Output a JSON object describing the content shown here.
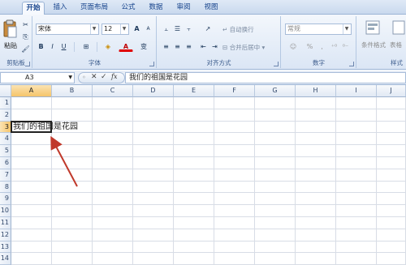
{
  "tabs": [
    {
      "label": "开始",
      "active": true
    },
    {
      "label": "插入"
    },
    {
      "label": "页面布局"
    },
    {
      "label": "公式"
    },
    {
      "label": "数据"
    },
    {
      "label": "审阅"
    },
    {
      "label": "视图"
    }
  ],
  "ribbon": {
    "clipboard": {
      "paste_label": "粘贴",
      "group_label": "剪贴板"
    },
    "font": {
      "name": "宋体",
      "size": "12",
      "bold": "B",
      "italic": "I",
      "underline": "U",
      "grow": "A",
      "shrink": "A",
      "font_color": "A",
      "wen": "变",
      "group_label": "字体"
    },
    "alignment": {
      "wrap_label": "自动换行",
      "merge_label": "合并后居中",
      "group_label": "对齐方式"
    },
    "number": {
      "format": "常规",
      "group_label": "数字"
    },
    "styles": {
      "conditional_label": "条件格式",
      "table_label": "表格",
      "group_label": "样式"
    }
  },
  "formula_bar": {
    "name_box": "A3",
    "fx_label": "fx",
    "content": "我们的祖国是花园"
  },
  "grid": {
    "columns": [
      "A",
      "B",
      "C",
      "D",
      "E",
      "F",
      "G",
      "H",
      "I",
      "J"
    ],
    "rows": [
      "1",
      "2",
      "3",
      "4",
      "5",
      "6",
      "7",
      "8",
      "9",
      "10",
      "11",
      "12",
      "13",
      "14"
    ],
    "selected_cell": "A3",
    "cell_a3_text": "我们的祖国是花园"
  },
  "colors": {
    "accent": "#15428b",
    "selection_header": "#f5c46a",
    "arrow": "#c0392b"
  }
}
